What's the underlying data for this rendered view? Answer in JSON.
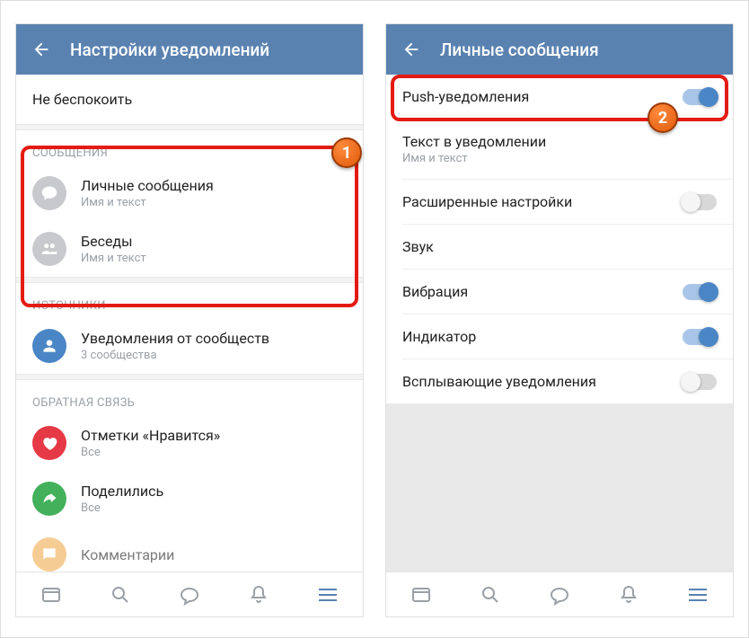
{
  "left": {
    "header": {
      "title": "Настройки уведомлений"
    },
    "dnd": "Не беспокоить",
    "sections": {
      "messages_header": "СООБЩЕНИЯ",
      "personal": {
        "title": "Личные сообщения",
        "sub": "Имя и текст"
      },
      "chats": {
        "title": "Беседы",
        "sub": "Имя и текст"
      },
      "sources_header": "ИСТОЧНИКИ",
      "communities": {
        "title": "Уведомления от сообществ",
        "sub": "3 сообщества"
      },
      "feedback_header": "ОБРАТНАЯ СВЯЗЬ",
      "likes": {
        "title": "Отметки «Нравится»",
        "sub": "Все"
      },
      "shares": {
        "title": "Поделились",
        "sub": "Все"
      },
      "comments": {
        "title": "Комментарии"
      }
    }
  },
  "right": {
    "header": {
      "title": "Личные сообщения"
    },
    "rows": {
      "push": "Push-уведомления",
      "text_in_notif": {
        "title": "Текст в уведомлении",
        "sub": "Имя и текст"
      },
      "advanced": "Расширенные настройки",
      "sound": "Звук",
      "vibration": "Вибрация",
      "indicator": "Индикатор",
      "popup": "Всплывающие уведомления"
    }
  },
  "badges": {
    "one": "1",
    "two": "2"
  }
}
